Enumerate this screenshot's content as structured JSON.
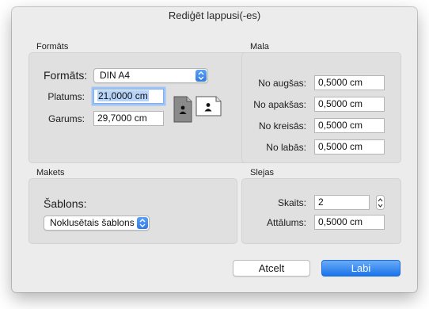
{
  "window": {
    "title": "Rediģēt lappusi(-es)"
  },
  "format_section": {
    "title": "Formāts",
    "format_label": "Formāts:",
    "format_value": "DIN A4",
    "width_label": "Platums:",
    "width_value": "21,0000 cm",
    "height_label": "Garums:",
    "height_value": "29,7000 cm",
    "orientation_icons": [
      "portrait-orientation-icon",
      "landscape-orientation-icon"
    ]
  },
  "margin_section": {
    "title": "Mala",
    "top_label": "No augšas:",
    "top_value": "0,5000 cm",
    "bottom_label": "No apakšas:",
    "bottom_value": "0,5000 cm",
    "left_label": "No kreisās:",
    "left_value": "0,5000 cm",
    "right_label": "No labās:",
    "right_value": "0,5000 cm"
  },
  "layout_section": {
    "title": "Makets",
    "template_label": "Šablons:",
    "template_value": "Noklusētais šablons"
  },
  "columns_section": {
    "title": "Slejas",
    "count_label": "Skaits:",
    "count_value": "2",
    "spacing_label": "Attālums:",
    "spacing_value": "0,5000 cm"
  },
  "buttons": {
    "cancel": "Atcelt",
    "ok": "Labi"
  },
  "colors": {
    "accent": "#1a73ea",
    "focus_ring": "#9ec3f5",
    "dialog_bg": "#ececec",
    "group_bg": "#e0e0e0"
  }
}
